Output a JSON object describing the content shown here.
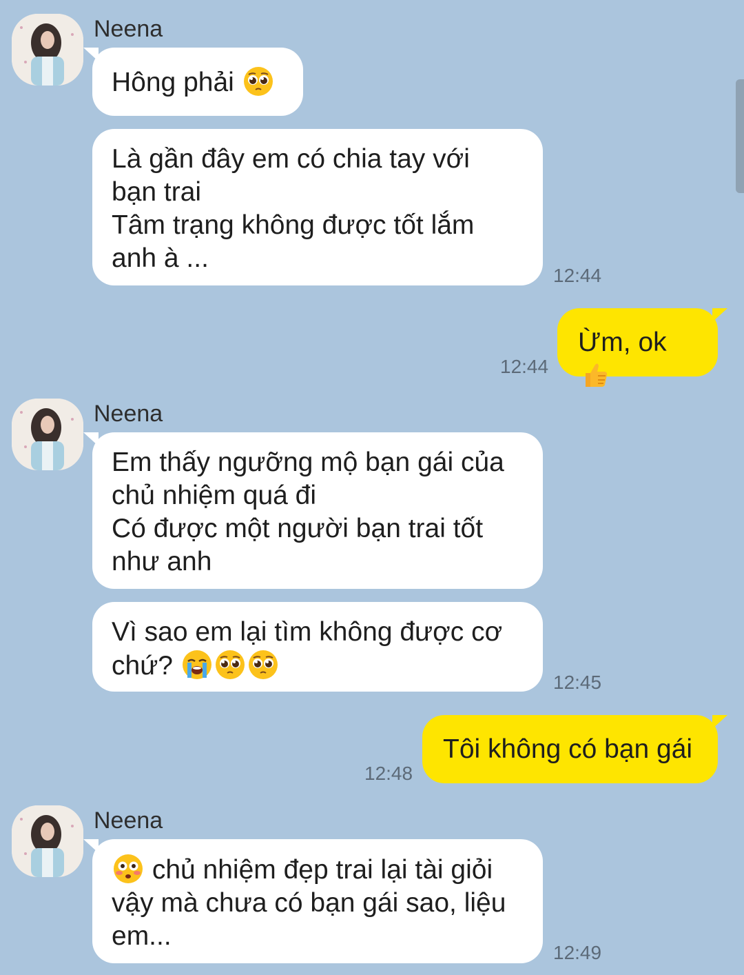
{
  "chat": {
    "messages": [
      {
        "id": "m1",
        "type": "incoming",
        "sender": "Neena",
        "text": "Hông phải",
        "emoji": [
          "pleading-face-emoji"
        ]
      },
      {
        "id": "m2",
        "type": "incoming",
        "text": "Là gần đây em có chia tay với\nbạn trai\nTâm trạng không được tốt lắm\nanh à ...",
        "time": "12:44"
      },
      {
        "id": "m3",
        "type": "outgoing",
        "text": "Ừm, ok",
        "emoji": [
          "thumbs-up-emoji"
        ],
        "time": "12:44"
      },
      {
        "id": "m4",
        "type": "incoming",
        "sender": "Neena",
        "text": "Em thấy ngưỡng mộ bạn gái của\nchủ nhiệm quá đi\nCó được một người bạn trai tốt\nnhư anh"
      },
      {
        "id": "m5",
        "type": "incoming",
        "text": "Vì sao em lại tìm không được cơ\nchứ?",
        "emoji": [
          "loudly-crying-face-emoji",
          "pleading-face-emoji",
          "pleading-face-emoji"
        ],
        "time": "12:45"
      },
      {
        "id": "m6",
        "type": "outgoing",
        "text": "Tôi không có bạn gái",
        "time": "12:48"
      },
      {
        "id": "m7",
        "type": "incoming",
        "sender": "Neena",
        "emoji_before": [
          "flushed-face-emoji"
        ],
        "text": " chủ nhiệm đẹp trai lại tài giỏi\nvậy mà chưa có bạn gái sao, liệu\nem...",
        "time": "12:49"
      }
    ]
  },
  "colors": {
    "background": "#abc5dd",
    "incoming_bubble": "#ffffff",
    "outgoing_bubble": "#fee500",
    "timestamp": "#5c6a78"
  }
}
